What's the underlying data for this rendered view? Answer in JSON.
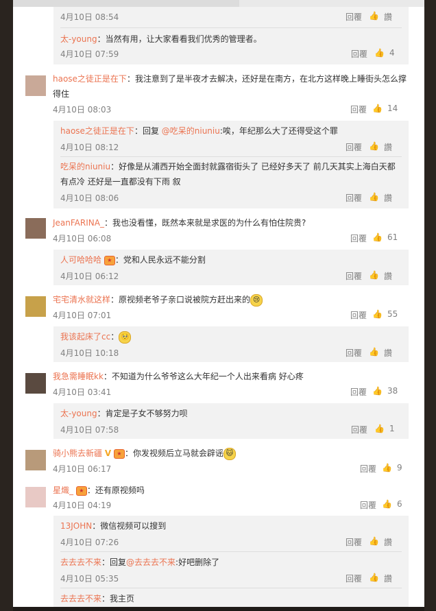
{
  "ui": {
    "reply_label": "回覆",
    "like_label": "讚"
  },
  "sub0": {
    "time": "4月10日 08:54",
    "like": "讚"
  },
  "sub1": {
    "user": "太-young",
    "text": "：当然有用，让大家看看我们优秀的管理者。",
    "time": "4月10日 07:59",
    "like": "4"
  },
  "c1": {
    "user": "haose之徒正是在下",
    "text": "：我注意到了是半夜才去解决，还好是在南方，在北方这样晚上睡街头怎么撑得住",
    "time": "4月10日 08:03",
    "like": "14"
  },
  "c1s1": {
    "user": "haose之徒正是在下",
    "text_pre": "：回复 ",
    "mention": "@吃呆的niuniu",
    "text_post": ":唉，年纪那么大了还得受这个罪",
    "time": "4月10日 08:12",
    "like": "讚"
  },
  "c1s2": {
    "user": "吃呆的niuniu",
    "text": "：好像是从浦西开始全面封就露宿街头了 已经好多天了 前几天其实上海白天都有点冷 还好是一直都没有下雨 叙",
    "time": "4月10日 08:06",
    "like": "讚"
  },
  "c2": {
    "user": "JeanFARINA_",
    "text": "：我也没看懂，既然本来就是求医的为什么有怕住院贵?",
    "time": "4月10日 06:08",
    "like": "61"
  },
  "c2s1": {
    "user": "人可哈哈哈",
    "text": "：党和人民永远不能分割",
    "time": "4月10日 06:12",
    "like": "讚"
  },
  "c3": {
    "user": "宅宅清水就这样",
    "text": "：原视频老爷子亲口说被院方赶出来的",
    "time": "4月10日 07:01",
    "like": "55"
  },
  "c3s1": {
    "user": "我该起床了cc",
    "text": "：",
    "time": "4月10日 10:18",
    "like": "讚"
  },
  "c4": {
    "user": "我急需睡眠kk",
    "text": "：不知道为什么爷爷这么大年纪一个人出来看病 好心疼",
    "time": "4月10日 03:41",
    "like": "38"
  },
  "c4s1": {
    "user": "太-young",
    "text": "：肯定是子女不够努力呗",
    "time": "4月10日 07:58",
    "like": "1"
  },
  "c5": {
    "user": "骑小熊去新疆",
    "v": "V",
    "text": "：你发视频后立马就会辟谣",
    "time": "4月10日 06:17",
    "like": "9"
  },
  "c6": {
    "user": "星熾_",
    "text": "：还有原视频吗",
    "time": "4月10日 04:19",
    "like": "6"
  },
  "c6s1": {
    "user": "13JOHN",
    "text": "：微信视频可以搜到",
    "time": "4月10日 07:26",
    "like": "讚"
  },
  "c6s2": {
    "user": "去去去不来",
    "text_pre": "：回复",
    "mention": "@去去去不来",
    "text_post": ":好吧删除了",
    "time": "4月10日 05:35",
    "like": "讚"
  },
  "c6s3": {
    "user": "去去去不来",
    "text": "：我主页"
  }
}
